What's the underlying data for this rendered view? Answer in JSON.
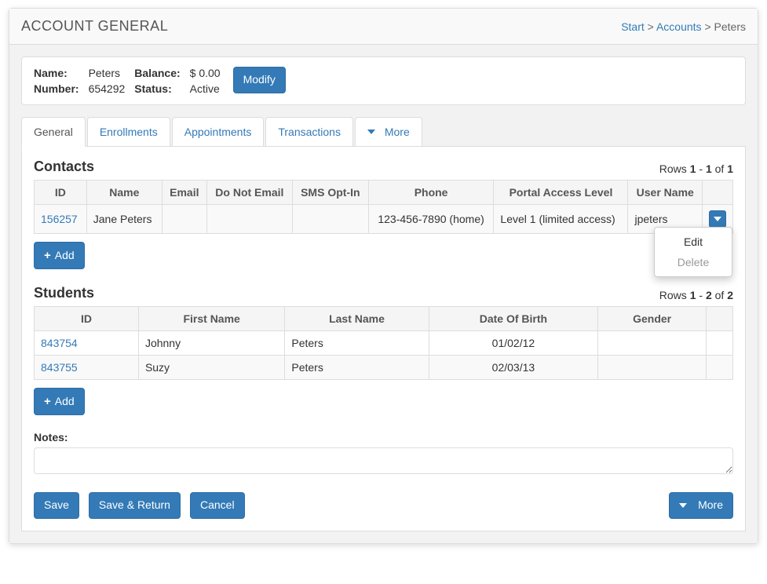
{
  "page_title": "ACCOUNT GENERAL",
  "breadcrumb": {
    "start": "Start",
    "accounts": "Accounts",
    "current": "Peters"
  },
  "account": {
    "labels": {
      "name": "Name:",
      "number": "Number:",
      "balance": "Balance:",
      "status": "Status:"
    },
    "name": "Peters",
    "number": "654292",
    "balance": "$ 0.00",
    "status": "Active",
    "modify_btn": "Modify"
  },
  "tabs": {
    "general": "General",
    "enrollments": "Enrollments",
    "appointments": "Appointments",
    "transactions": "Transactions",
    "more": "More"
  },
  "contacts": {
    "title": "Contacts",
    "rows_info": {
      "prefix": "Rows ",
      "from": "1",
      "sep1": " - ",
      "to": "1",
      "sep2": " of ",
      "total": "1"
    },
    "headers": {
      "id": "ID",
      "name": "Name",
      "email": "Email",
      "do_not_email": "Do Not Email",
      "sms_opt_in": "SMS Opt-In",
      "phone": "Phone",
      "portal": "Portal Access Level",
      "user": "User Name"
    },
    "rows": [
      {
        "id": "156257",
        "name": "Jane Peters",
        "email": "",
        "do_not_email": "",
        "sms_opt_in": "",
        "phone": "123-456-7890 (home)",
        "portal": "Level 1 (limited access)",
        "user": "jpeters"
      }
    ],
    "row_actions": {
      "edit": "Edit",
      "delete": "Delete"
    },
    "add_btn": "Add"
  },
  "students": {
    "title": "Students",
    "rows_info": {
      "prefix": "Rows ",
      "from": "1",
      "sep1": " - ",
      "to": "2",
      "sep2": " of ",
      "total": "2"
    },
    "headers": {
      "id": "ID",
      "first": "First Name",
      "last": "Last Name",
      "dob": "Date Of Birth",
      "gender": "Gender"
    },
    "rows": [
      {
        "id": "843754",
        "first": "Johnny",
        "last": "Peters",
        "dob": "01/02/12",
        "gender": ""
      },
      {
        "id": "843755",
        "first": "Suzy",
        "last": "Peters",
        "dob": "02/03/13",
        "gender": ""
      }
    ],
    "add_btn": "Add"
  },
  "notes": {
    "label": "Notes:",
    "value": ""
  },
  "footer": {
    "save": "Save",
    "save_return": "Save & Return",
    "cancel": "Cancel",
    "more": "More"
  }
}
